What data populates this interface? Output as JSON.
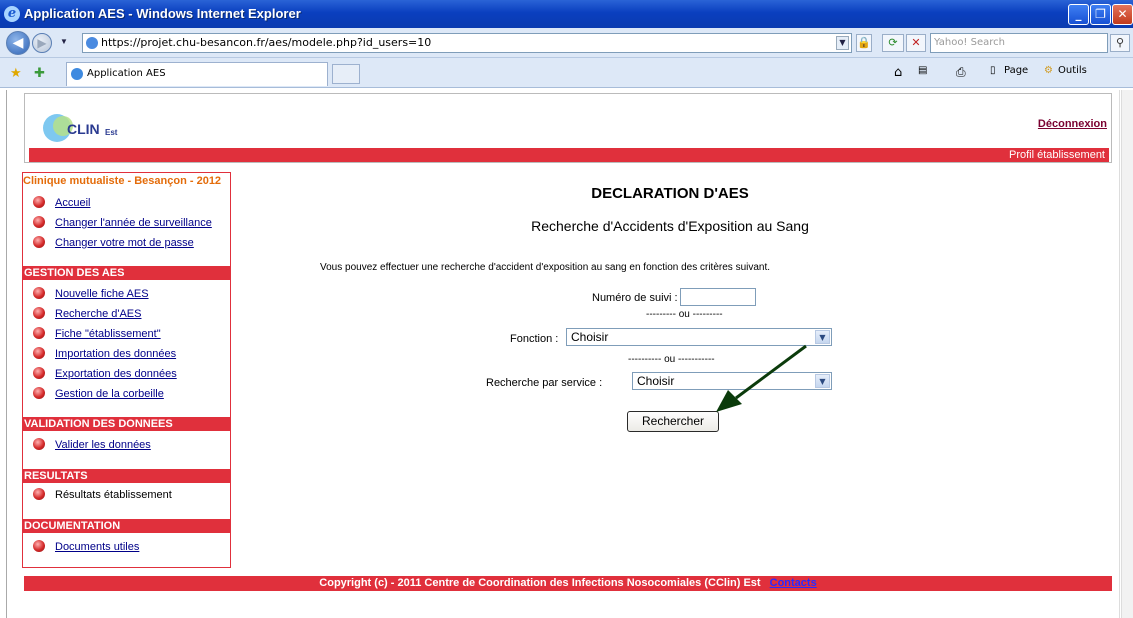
{
  "window": {
    "title": "Application AES - Windows Internet Explorer",
    "minimize_icon": "minimize-icon",
    "maximize_icon": "restore-icon",
    "close_icon": "close-icon"
  },
  "browser": {
    "url": "https://projet.chu-besancon.fr/aes/modele.php?id_users=10",
    "search_placeholder": "Yahoo! Search",
    "tab_label": "Application AES",
    "page_menu": "Page",
    "tools_menu": "Outils"
  },
  "header": {
    "logo_text": "CLIN",
    "logo_suffix": "Est",
    "logout": "Déconnexion",
    "profile": "Profil établissement"
  },
  "sidebar": {
    "establishment": "Clinique mutualiste - Besançon - 2012",
    "top_items": [
      "Accueil",
      "Changer l'année de surveillance",
      "Changer votre mot de passe"
    ],
    "sections": [
      {
        "title": "GESTION DES AES",
        "items": [
          "Nouvelle fiche AES",
          "Recherche d'AES",
          "Fiche \"établissement\"",
          "Importation des données",
          "Exportation des données",
          "Gestion de la corbeille"
        ]
      },
      {
        "title": "VALIDATION DES DONNEES",
        "items": [
          "Valider les données"
        ]
      },
      {
        "title": "RESULTATS",
        "items": [
          "Résultats établissement"
        ]
      },
      {
        "title": "DOCUMENTATION",
        "items": [
          "Documents utiles"
        ]
      }
    ]
  },
  "main": {
    "title": "DECLARATION D'AES",
    "subtitle": "Recherche d'Accidents d'Exposition au Sang",
    "intro": "Vous pouvez effectuer une recherche d'accident d'exposition au sang en fonction des critères suivant.",
    "suivi_label": "Numéro de suivi :",
    "suivi_value": "",
    "separator1": "--------- ou ---------",
    "fonction_label": "Fonction :",
    "fonction_value": "Choisir",
    "separator2": "---------- ou -----------",
    "service_label": "Recherche par service :",
    "service_value": "Choisir",
    "search_button": "Rechercher"
  },
  "footer": {
    "copyright": "Copyright (c) - 2011 Centre de Coordination des Infections Nosocomiales (CClin) Est",
    "contacts": "Contacts"
  },
  "colors": {
    "accent_red": "#e0303c",
    "link_blue": "#000088",
    "establishment_orange": "#e46c0a",
    "annotation_arrow": "#0b3b0b"
  }
}
